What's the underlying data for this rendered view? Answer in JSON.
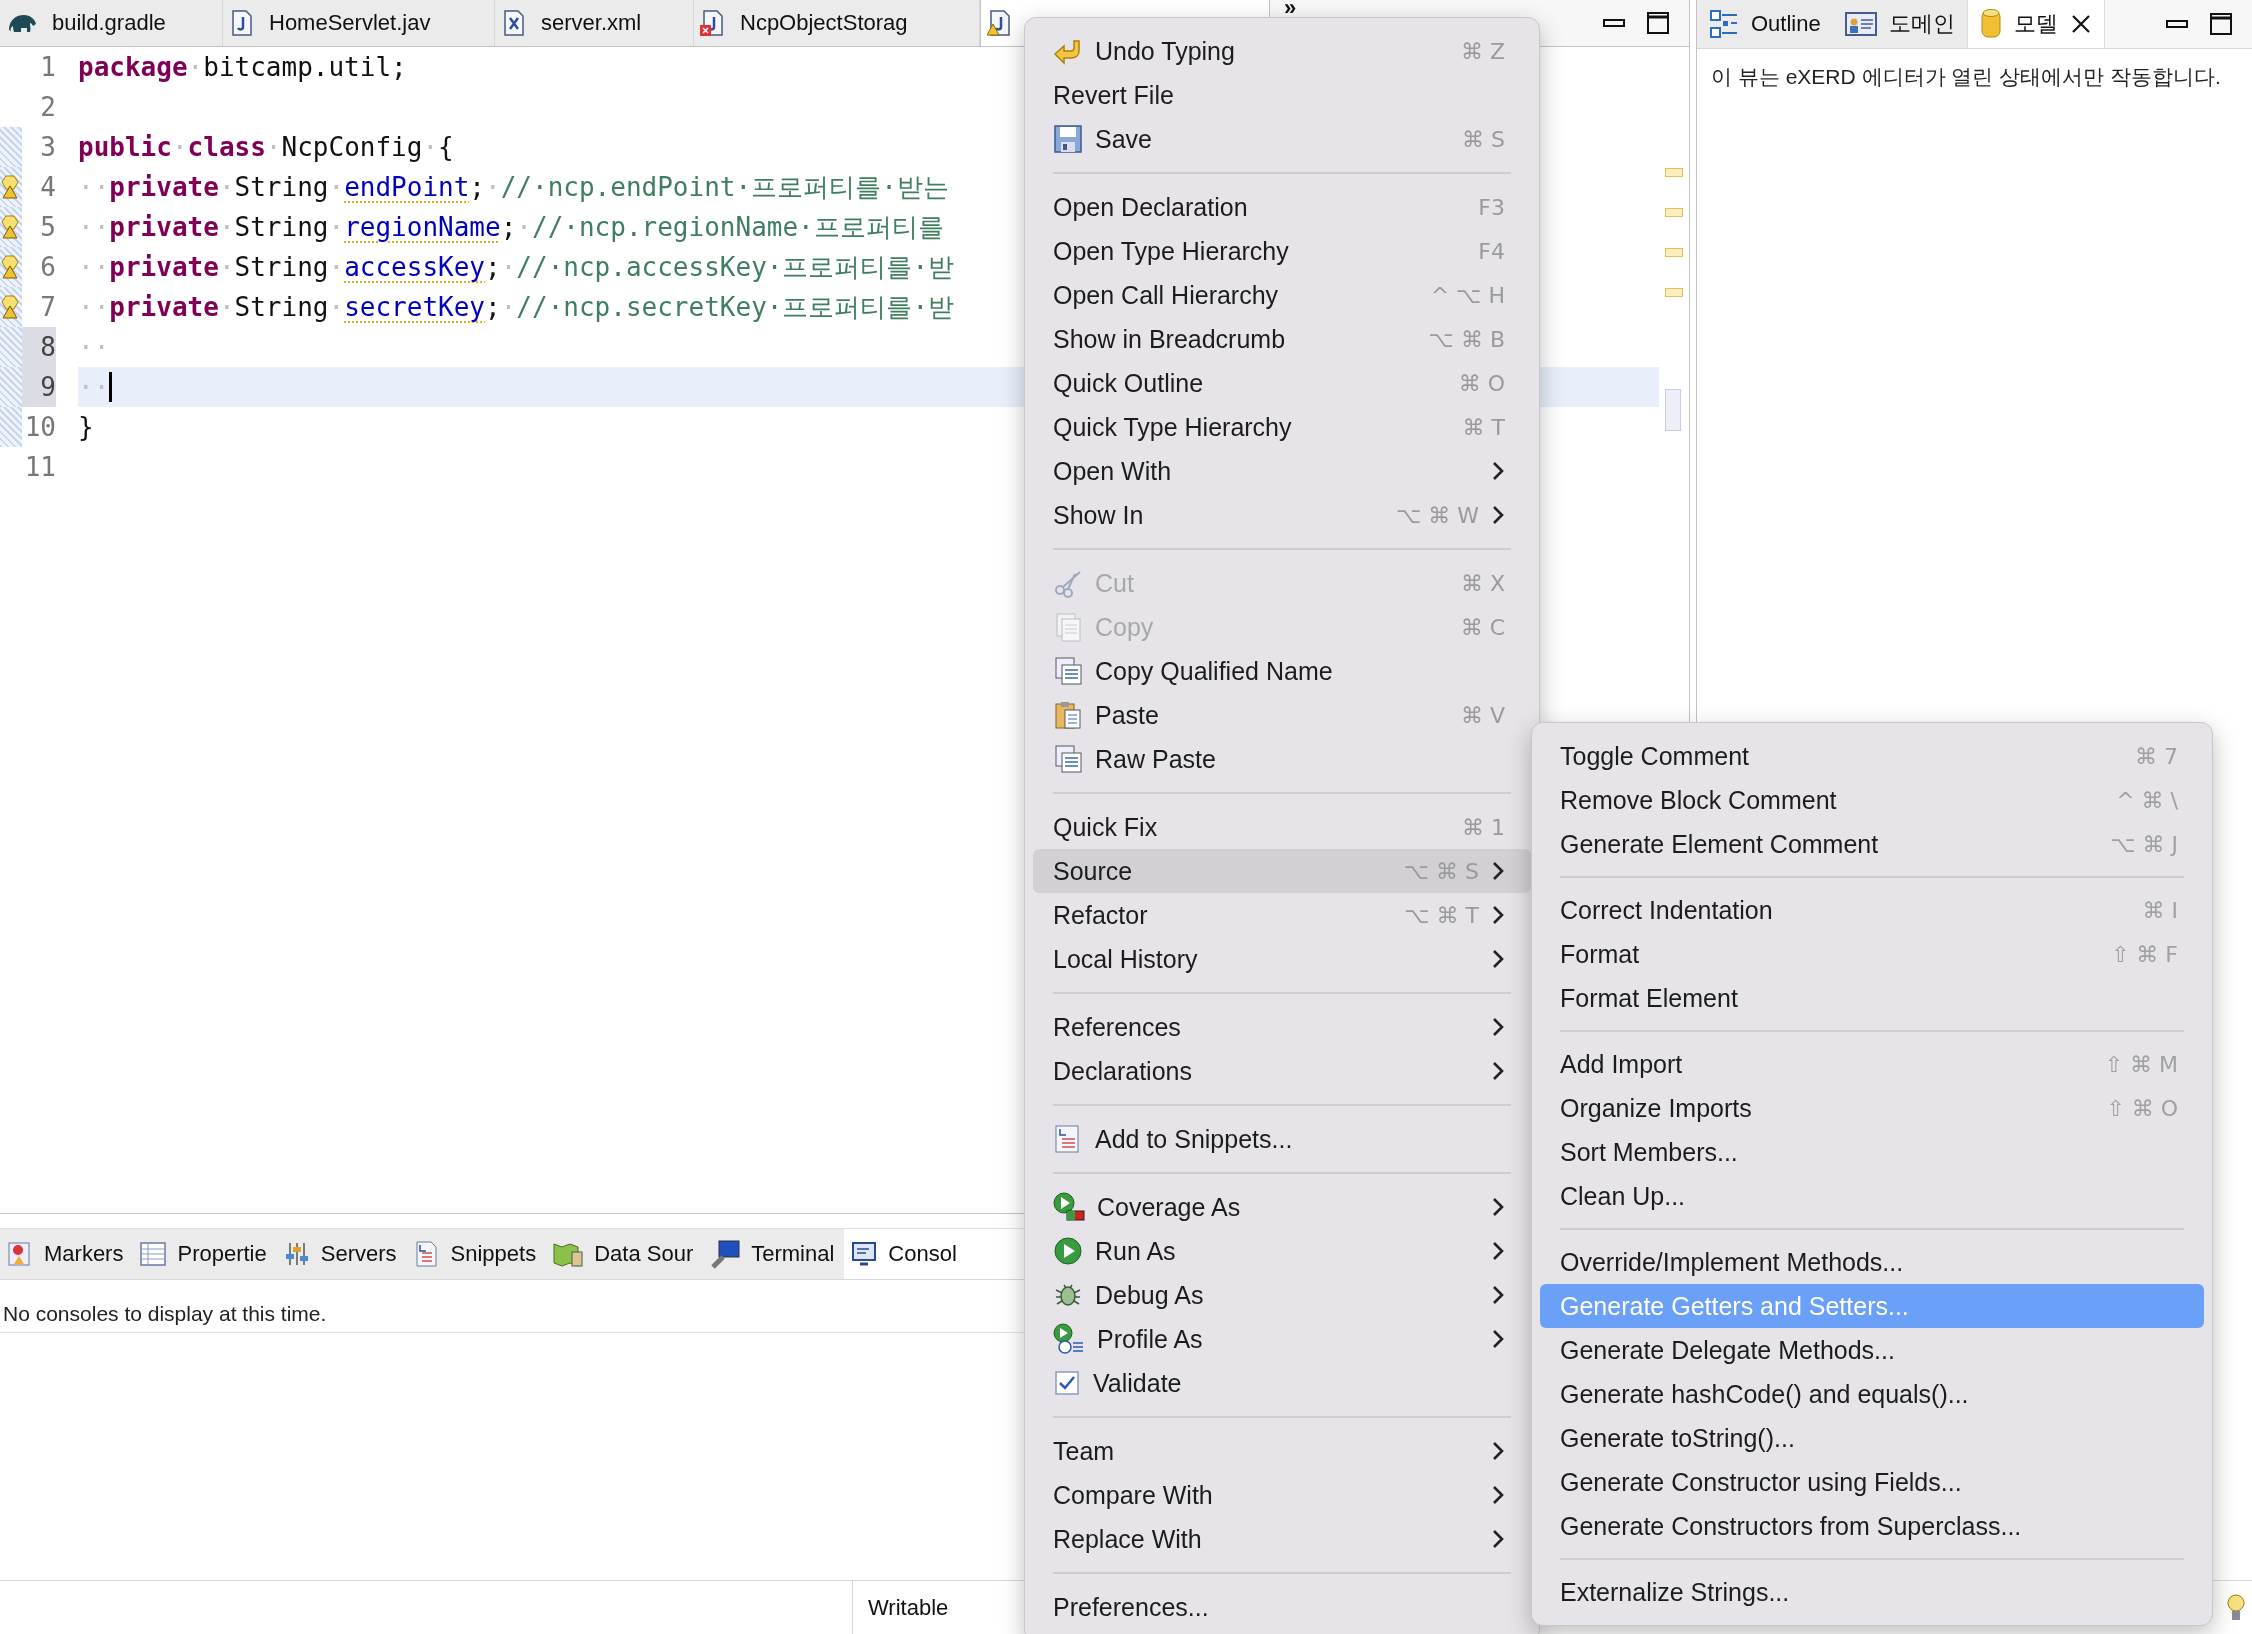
{
  "editor_tabs": [
    {
      "label": "build.gradle",
      "selected": false
    },
    {
      "label": "HomeServlet.jav",
      "selected": false
    },
    {
      "label": "server.xml",
      "selected": false
    },
    {
      "label": "NcpObjectStorag",
      "selected": false
    },
    {
      "selected": true
    }
  ],
  "editor_overflow": "»",
  "code_lines": [
    {
      "number": "1",
      "changed": false,
      "warning": false,
      "highlighted": false,
      "current": false,
      "tokens": [
        {
          "kind": "keyword",
          "text": "package"
        },
        {
          "kind": "space",
          "text": "·"
        },
        {
          "kind": "plain",
          "text": "bitcamp.util;"
        }
      ]
    },
    {
      "number": "2",
      "changed": false,
      "warning": false,
      "highlighted": false,
      "current": false
    },
    {
      "number": "3",
      "changed": true,
      "warning": false,
      "highlighted": false,
      "current": false,
      "tokens": [
        {
          "kind": "keyword",
          "text": "public"
        },
        {
          "kind": "space",
          "text": "·"
        },
        {
          "kind": "keyword",
          "text": "class"
        },
        {
          "kind": "space",
          "text": "·"
        },
        {
          "kind": "plain",
          "text": "NcpConfig"
        },
        {
          "kind": "space",
          "text": "·"
        },
        {
          "kind": "plain",
          "text": "{"
        }
      ]
    },
    {
      "number": "4",
      "changed": true,
      "warning": true,
      "highlighted": false,
      "current": false,
      "tokens": [
        {
          "kind": "space",
          "text": "··"
        },
        {
          "kind": "keyword",
          "text": "private"
        },
        {
          "kind": "space",
          "text": "·"
        },
        {
          "kind": "plain",
          "text": "String"
        },
        {
          "kind": "space",
          "text": "·"
        },
        {
          "kind": "field",
          "text": "endPoint"
        },
        {
          "kind": "plain",
          "text": ";"
        },
        {
          "kind": "space",
          "text": "·"
        },
        {
          "kind": "comment",
          "text": "//·ncp.endPoint·프로퍼티를·받는"
        }
      ]
    },
    {
      "number": "5",
      "changed": true,
      "warning": true,
      "highlighted": false,
      "current": false,
      "tokens": [
        {
          "kind": "space",
          "text": "··"
        },
        {
          "kind": "keyword",
          "text": "private"
        },
        {
          "kind": "space",
          "text": "·"
        },
        {
          "kind": "plain",
          "text": "String"
        },
        {
          "kind": "space",
          "text": "·"
        },
        {
          "kind": "field",
          "text": "regionName"
        },
        {
          "kind": "plain",
          "text": ";"
        },
        {
          "kind": "space",
          "text": "·"
        },
        {
          "kind": "comment",
          "text": "//·ncp.regionName·프로퍼티를"
        }
      ]
    },
    {
      "number": "6",
      "changed": true,
      "warning": true,
      "highlighted": false,
      "current": false,
      "tokens": [
        {
          "kind": "space",
          "text": "··"
        },
        {
          "kind": "keyword",
          "text": "private"
        },
        {
          "kind": "space",
          "text": "·"
        },
        {
          "kind": "plain",
          "text": "String"
        },
        {
          "kind": "space",
          "text": "·"
        },
        {
          "kind": "field",
          "text": "accessKey"
        },
        {
          "kind": "plain",
          "text": ";"
        },
        {
          "kind": "space",
          "text": "·"
        },
        {
          "kind": "comment",
          "text": "//·ncp.accessKey·프로퍼티를·받"
        }
      ]
    },
    {
      "number": "7",
      "changed": true,
      "warning": true,
      "highlighted": false,
      "current": false,
      "tokens": [
        {
          "kind": "space",
          "text": "··"
        },
        {
          "kind": "keyword",
          "text": "private"
        },
        {
          "kind": "space",
          "text": "·"
        },
        {
          "kind": "plain",
          "text": "String"
        },
        {
          "kind": "space",
          "text": "·"
        },
        {
          "kind": "field",
          "text": "secretKey"
        },
        {
          "kind": "plain",
          "text": ";"
        },
        {
          "kind": "space",
          "text": "·"
        },
        {
          "kind": "comment",
          "text": "//·ncp.secretKey·프로퍼티를·받"
        }
      ]
    },
    {
      "number": "8",
      "changed": true,
      "warning": false,
      "highlighted": true,
      "current": false,
      "tokens": [
        {
          "kind": "space",
          "text": "··"
        }
      ]
    },
    {
      "number": "9",
      "changed": true,
      "warning": false,
      "highlighted": true,
      "current": true,
      "tokens": [
        {
          "kind": "space",
          "text": "··"
        }
      ]
    },
    {
      "number": "10",
      "changed": true,
      "warning": false,
      "highlighted": false,
      "current": false,
      "tokens": [
        {
          "kind": "plain",
          "text": "}"
        }
      ]
    },
    {
      "number": "11",
      "changed": false,
      "warning": false,
      "highlighted": false,
      "current": false
    }
  ],
  "bottom_tabs": [
    {
      "label": "Markers",
      "selected": false
    },
    {
      "label": "Propertie",
      "selected": false
    },
    {
      "label": "Servers",
      "selected": false
    },
    {
      "label": "Snippets",
      "selected": false
    },
    {
      "label": "Data Sour",
      "selected": false
    },
    {
      "label": "Terminal",
      "selected": false
    },
    {
      "label": "Consol",
      "selected": true
    }
  ],
  "console_message": "No consoles to display at this time.",
  "right_tabs": [
    {
      "label": "Outline",
      "selected": false,
      "closable": false
    },
    {
      "label": "도메인",
      "selected": false,
      "closable": false
    },
    {
      "label": "모델",
      "selected": true,
      "closable": true
    }
  ],
  "right_message": "이 뷰는 eXERD 에디터가 열린 상태에서만 작동합니다.",
  "status_bar": {
    "mode": "Writable"
  },
  "context_menu": {
    "items": [
      {
        "kind": "item",
        "label": "Undo Typing",
        "shortcut": "⌘ Z",
        "submenu": false,
        "disabled": false,
        "selected": false
      },
      {
        "kind": "item",
        "label": "Revert File",
        "submenu": false,
        "disabled": false,
        "selected": false
      },
      {
        "kind": "item",
        "label": "Save",
        "shortcut": "⌘ S",
        "submenu": false,
        "disabled": false,
        "selected": false
      },
      {
        "kind": "separator"
      },
      {
        "kind": "item",
        "label": "Open Declaration",
        "shortcut": "F3",
        "submenu": false,
        "disabled": false,
        "selected": false
      },
      {
        "kind": "item",
        "label": "Open Type Hierarchy",
        "shortcut": "F4",
        "submenu": false,
        "disabled": false,
        "selected": false
      },
      {
        "kind": "item",
        "label": "Open Call Hierarchy",
        "shortcut": "^ ⌥ H",
        "submenu": false,
        "disabled": false,
        "selected": false
      },
      {
        "kind": "item",
        "label": "Show in Breadcrumb",
        "shortcut": "⌥ ⌘ B",
        "submenu": false,
        "disabled": false,
        "selected": false
      },
      {
        "kind": "item",
        "label": "Quick Outline",
        "shortcut": "⌘ O",
        "submenu": false,
        "disabled": false,
        "selected": false
      },
      {
        "kind": "item",
        "label": "Quick Type Hierarchy",
        "shortcut": "⌘ T",
        "submenu": false,
        "disabled": false,
        "selected": false
      },
      {
        "kind": "item",
        "label": "Open With",
        "submenu": true,
        "disabled": false,
        "selected": false
      },
      {
        "kind": "item",
        "label": "Show In",
        "shortcut": "⌥ ⌘ W",
        "submenu": true,
        "disabled": false,
        "selected": false
      },
      {
        "kind": "separator"
      },
      {
        "kind": "item",
        "label": "Cut",
        "shortcut": "⌘ X",
        "submenu": false,
        "disabled": true,
        "selected": false
      },
      {
        "kind": "item",
        "label": "Copy",
        "shortcut": "⌘ C",
        "submenu": false,
        "disabled": true,
        "selected": false
      },
      {
        "kind": "item",
        "label": "Copy Qualified Name",
        "submenu": false,
        "disabled": false,
        "selected": false
      },
      {
        "kind": "item",
        "label": "Paste",
        "shortcut": "⌘ V",
        "submenu": false,
        "disabled": false,
        "selected": false
      },
      {
        "kind": "item",
        "label": "Raw Paste",
        "submenu": false,
        "disabled": false,
        "selected": false
      },
      {
        "kind": "separator"
      },
      {
        "kind": "item",
        "label": "Quick Fix",
        "shortcut": "⌘ 1",
        "submenu": false,
        "disabled": false,
        "selected": false
      },
      {
        "kind": "item",
        "label": "Source",
        "shortcut": "⌥ ⌘ S",
        "submenu": true,
        "disabled": false,
        "selected": true
      },
      {
        "kind": "item",
        "label": "Refactor",
        "shortcut": "⌥ ⌘ T",
        "submenu": true,
        "disabled": false,
        "selected": false
      },
      {
        "kind": "item",
        "label": "Local History",
        "submenu": true,
        "disabled": false,
        "selected": false
      },
      {
        "kind": "separator"
      },
      {
        "kind": "item",
        "label": "References",
        "submenu": true,
        "disabled": false,
        "selected": false
      },
      {
        "kind": "item",
        "label": "Declarations",
        "submenu": true,
        "disabled": false,
        "selected": false
      },
      {
        "kind": "separator"
      },
      {
        "kind": "item",
        "label": "Add to Snippets...",
        "submenu": false,
        "disabled": false,
        "selected": false
      },
      {
        "kind": "separator"
      },
      {
        "kind": "item",
        "label": "Coverage As",
        "submenu": true,
        "disabled": false,
        "selected": false
      },
      {
        "kind": "item",
        "label": "Run As",
        "submenu": true,
        "disabled": false,
        "selected": false
      },
      {
        "kind": "item",
        "label": "Debug As",
        "submenu": true,
        "disabled": false,
        "selected": false
      },
      {
        "kind": "item",
        "label": "Profile As",
        "submenu": true,
        "disabled": false,
        "selected": false
      },
      {
        "kind": "item",
        "label": "Validate",
        "submenu": false,
        "disabled": false,
        "selected": false
      },
      {
        "kind": "separator"
      },
      {
        "kind": "item",
        "label": "Team",
        "submenu": true,
        "disabled": false,
        "selected": false
      },
      {
        "kind": "item",
        "label": "Compare With",
        "submenu": true,
        "disabled": false,
        "selected": false
      },
      {
        "kind": "item",
        "label": "Replace With",
        "submenu": true,
        "disabled": false,
        "selected": false
      },
      {
        "kind": "separator"
      },
      {
        "kind": "item",
        "label": "Preferences...",
        "submenu": false,
        "disabled": false,
        "selected": false
      }
    ]
  },
  "source_submenu": {
    "items": [
      {
        "kind": "item",
        "label": "Toggle Comment",
        "shortcut": "⌘ 7",
        "selected": false
      },
      {
        "kind": "item",
        "label": "Remove Block Comment",
        "shortcut": "^ ⌘ \\",
        "selected": false
      },
      {
        "kind": "item",
        "label": "Generate Element Comment",
        "shortcut": "⌥ ⌘ J",
        "selected": false
      },
      {
        "kind": "separator"
      },
      {
        "kind": "item",
        "label": "Correct Indentation",
        "shortcut": "⌘ I",
        "selected": false
      },
      {
        "kind": "item",
        "label": "Format",
        "shortcut": "⇧ ⌘ F",
        "selected": false
      },
      {
        "kind": "item",
        "label": "Format Element",
        "selected": false
      },
      {
        "kind": "separator"
      },
      {
        "kind": "item",
        "label": "Add Import",
        "shortcut": "⇧ ⌘ M",
        "selected": false
      },
      {
        "kind": "item",
        "label": "Organize Imports",
        "shortcut": "⇧ ⌘ O",
        "selected": false
      },
      {
        "kind": "item",
        "label": "Sort Members...",
        "selected": false
      },
      {
        "kind": "item",
        "label": "Clean Up...",
        "selected": false
      },
      {
        "kind": "separator"
      },
      {
        "kind": "item",
        "label": "Override/Implement Methods...",
        "selected": false
      },
      {
        "kind": "item",
        "label": "Generate Getters and Setters...",
        "selected": true
      },
      {
        "kind": "item",
        "label": "Generate Delegate Methods...",
        "selected": false
      },
      {
        "kind": "item",
        "label": "Generate hashCode() and equals()...",
        "selected": false
      },
      {
        "kind": "item",
        "label": "Generate toString()...",
        "selected": false
      },
      {
        "kind": "item",
        "label": "Generate Constructor using Fields...",
        "selected": false
      },
      {
        "kind": "item",
        "label": "Generate Constructors from Superclass...",
        "selected": false
      },
      {
        "kind": "separator"
      },
      {
        "kind": "item",
        "label": "Externalize Strings...",
        "selected": false
      }
    ]
  }
}
